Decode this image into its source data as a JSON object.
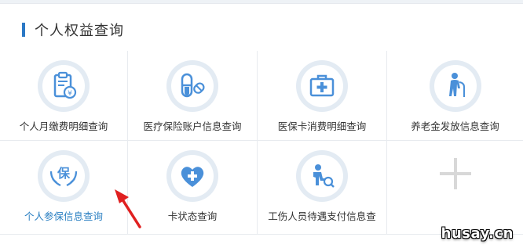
{
  "section": {
    "title": "个人权益查询"
  },
  "items": [
    {
      "label": "个人月缴费明细查询",
      "icon": "monthly-payment-icon"
    },
    {
      "label": "医疗保险账户信息查询",
      "icon": "medical-insurance-icon"
    },
    {
      "label": "医保卡消费明细查询",
      "icon": "medical-kit-icon"
    },
    {
      "label": "养老金发放信息查询",
      "icon": "elderly-pension-icon"
    },
    {
      "label": "个人参保信息查询",
      "icon": "insurance-hands-icon",
      "active": true
    },
    {
      "label": "卡状态查询",
      "icon": "heart-cross-icon"
    },
    {
      "label": "工伤人员待遇支付信息查",
      "icon": "injured-worker-icon"
    },
    {
      "label": "",
      "icon": "add-plus-icon"
    }
  ],
  "watermark": "husay.cn",
  "colors": {
    "accent": "#2b78c5",
    "icon_blue": "#4a90d9",
    "arrow": "#e02020",
    "ring": "#e3ebf3"
  }
}
